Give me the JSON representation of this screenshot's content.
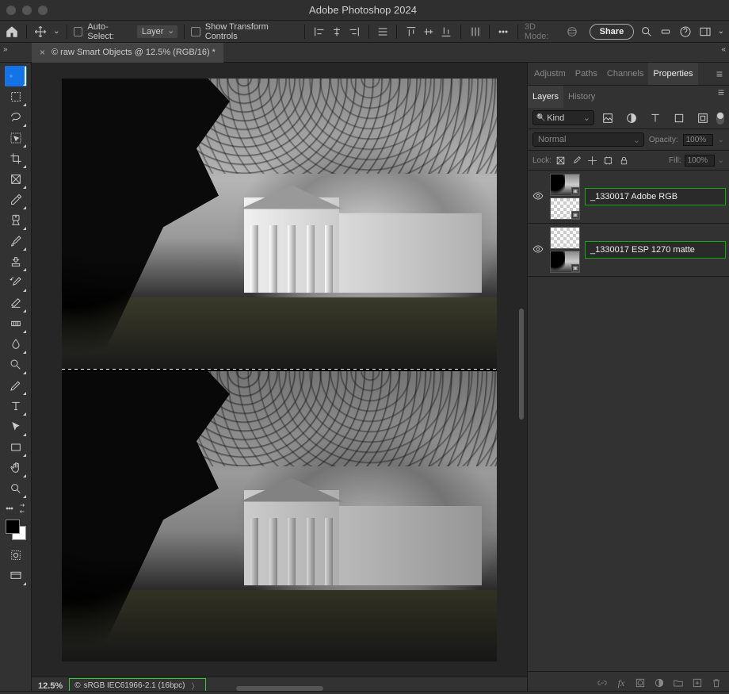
{
  "app_title": "Adobe Photoshop 2024",
  "options_bar": {
    "auto_select_label": "Auto-Select:",
    "auto_select_target": "Layer",
    "show_transform_label": "Show Transform Controls",
    "mode3d_label": "3D Mode:",
    "share_label": "Share"
  },
  "document": {
    "tab_title": "© raw Smart Objects @ 12.5% (RGB/16) *",
    "zoom": "12.5%",
    "color_profile": "sRGB IEC61966-2.1 (16bpc)"
  },
  "panel_tabs": {
    "adjustments": "Adjustm",
    "paths": "Paths",
    "channels": "Channels",
    "properties": "Properties",
    "layers": "Layers",
    "history": "History"
  },
  "layers_panel": {
    "kind_label": "Kind",
    "blend_mode": "Normal",
    "opacity_label": "Opacity:",
    "opacity_value": "100%",
    "lock_label": "Lock:",
    "fill_label": "Fill:",
    "fill_value": "100%",
    "layers": [
      {
        "name": "_1330017 Adobe RGB"
      },
      {
        "name": "_1330017 ESP 1270 matte"
      }
    ]
  }
}
